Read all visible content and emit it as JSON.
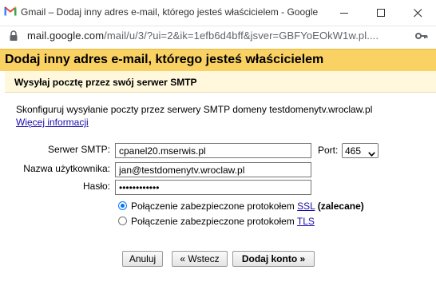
{
  "window": {
    "title": "Gmail – Dodaj inny adres e-mail, którego jesteś właścicielem - Google C...",
    "url_host": "mail.google.com",
    "url_path": "/mail/u/3/?ui=2&ik=1efb6d4bff&jsver=GBFYoEOkW1w.pl....",
    "icons": [
      "gmail-logo",
      "minimize",
      "maximize",
      "close",
      "lock",
      "key"
    ]
  },
  "dialog": {
    "title": "Dodaj inny adres e-mail, którego jesteś właścicielem",
    "subtitle": "Wysyłaj pocztę przez swój serwer SMTP",
    "description": "Skonfiguruj wysyłanie poczty przez serwery SMTP domeny testdomenytv.wroclaw.pl",
    "more_info_link": "Więcej informacji",
    "accent_color": "#fad163"
  },
  "form": {
    "smtp_label": "Serwer SMTP:",
    "smtp_value": "cpanel20.mserwis.pl",
    "port_label": "Port:",
    "port_value": "465",
    "username_label": "Nazwa użytkownika:",
    "username_value": "jan@testdomenytv.wroclaw.pl",
    "password_label": "Hasło:",
    "password_value": "••••••••••••",
    "ssl_option": {
      "prefix": "Połączenie zabezpieczone protokołem",
      "link": "SSL",
      "suffix": "(zalecane)",
      "checked": true
    },
    "tls_option": {
      "prefix": "Połączenie zabezpieczone protokołem",
      "link": "TLS",
      "checked": false
    }
  },
  "buttons": {
    "cancel": "Anuluj",
    "back": "« Wstecz",
    "add": "Dodaj konto »"
  }
}
